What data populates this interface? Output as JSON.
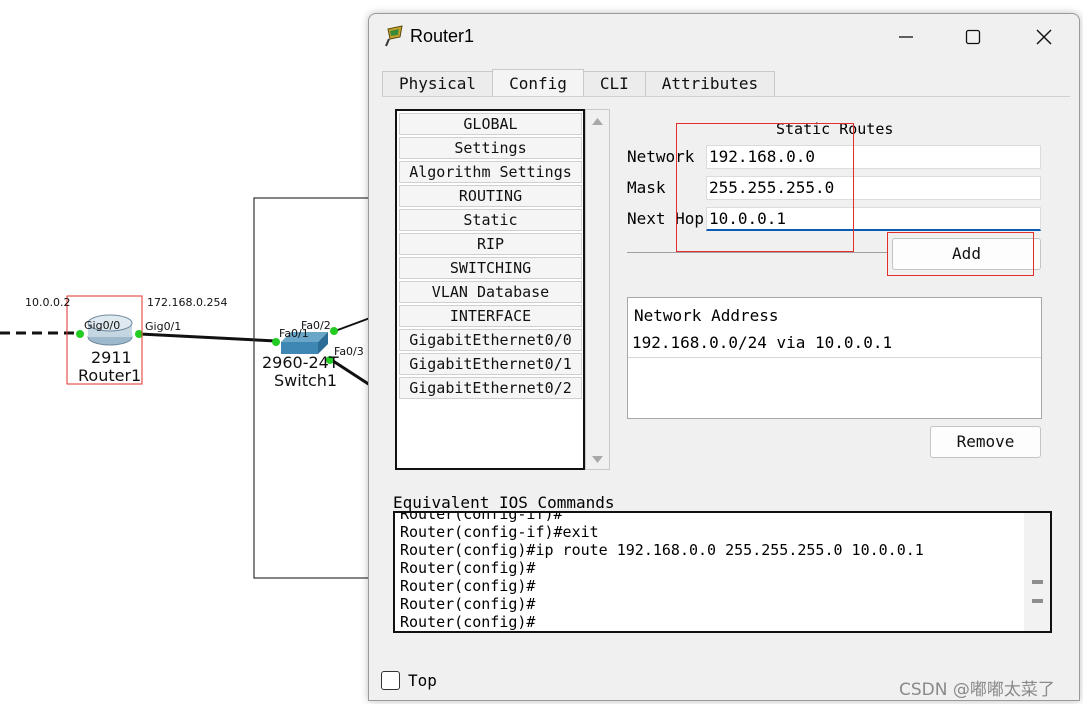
{
  "topology": {
    "router": {
      "model": "2911",
      "name": "Router1",
      "left_ip": "10.0.0.2",
      "right_ip": "172.168.0.254",
      "port_left": "Gig0/0",
      "port_right": "Gig0/1"
    },
    "switch": {
      "model": "2960-24T",
      "name": "Switch1",
      "port_fa01": "Fa0/1",
      "port_fa02": "Fa0/2",
      "port_fa03": "Fa0/3"
    }
  },
  "window": {
    "title": "Router1",
    "minimize_icon": "minimize-icon",
    "maximize_icon": "maximize-icon",
    "close_icon": "close-icon"
  },
  "tabs": [
    "Physical",
    "Config",
    "CLI",
    "Attributes"
  ],
  "active_tab": "Config",
  "nav_items": [
    "GLOBAL",
    "Settings",
    "Algorithm Settings",
    "ROUTING",
    "Static",
    "RIP",
    "SWITCHING",
    "VLAN Database",
    "INTERFACE",
    "GigabitEthernet0/0",
    "GigabitEthernet0/1",
    "GigabitEthernet0/2"
  ],
  "static_routes": {
    "title": "Static Routes",
    "network_label": "Network",
    "network_value": "192.168.0.0",
    "mask_label": "Mask",
    "mask_value": "255.255.255.0",
    "nexthop_label": "Next Hop",
    "nexthop_value": "10.0.0.1",
    "add_button": "Add",
    "list_header": "Network Address",
    "list_rows": [
      "192.168.0.0/24 via 10.0.0.1"
    ],
    "remove_button": "Remove"
  },
  "ios": {
    "label": "Equivalent IOS Commands",
    "lines": [
      "Router(config-if)#",
      "Router(config-if)#exit",
      "Router(config)#ip route 192.168.0.0 255.255.255.0 10.0.0.1",
      "Router(config)#",
      "Router(config)#",
      "Router(config)#",
      "Router(config)#"
    ]
  },
  "footer": {
    "top_label": "Top"
  },
  "watermark": "CSDN @嘟嘟太菜了"
}
